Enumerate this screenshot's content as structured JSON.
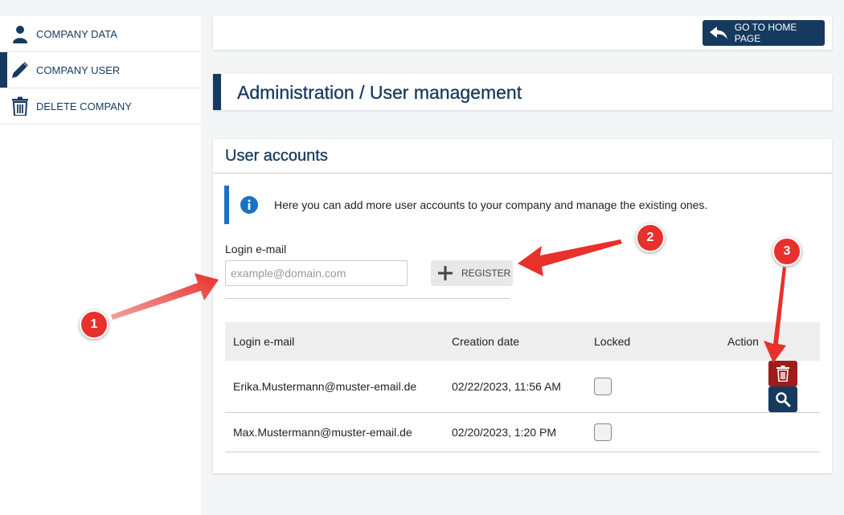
{
  "sidebar": {
    "items": [
      {
        "label": "COMPANY DATA",
        "icon": "person-icon"
      },
      {
        "label": "COMPANY USER",
        "icon": "pencil-icon",
        "active": true
      },
      {
        "label": "DELETE COMPANY",
        "icon": "trash-icon"
      }
    ]
  },
  "topbar": {
    "home_button": "GO TO HOME PAGE"
  },
  "page": {
    "title": "Administration / User management"
  },
  "accounts": {
    "title": "User accounts",
    "info": "Here you can add more user accounts to your company and manage the existing ones.",
    "login_label": "Login e-mail",
    "login_placeholder": "example@domain.com",
    "register_button": "REGISTER",
    "table": {
      "headers": [
        "Login e-mail",
        "Creation date",
        "Locked",
        "Action"
      ],
      "rows": [
        {
          "email": "Erika.Mustermann@muster-email.de",
          "date": "02/22/2023, 11:56 AM",
          "locked": false,
          "actions": true
        },
        {
          "email": "Max.Mustermann@muster-email.de",
          "date": "02/20/2023, 1:20 PM",
          "locked": false,
          "actions": false
        }
      ]
    }
  },
  "annotations": [
    "1",
    "2",
    "3"
  ],
  "colors": {
    "primary": "#163a5f",
    "danger": "#9d1c1c",
    "info": "#1a72c4",
    "annotation": "#e8302c"
  }
}
